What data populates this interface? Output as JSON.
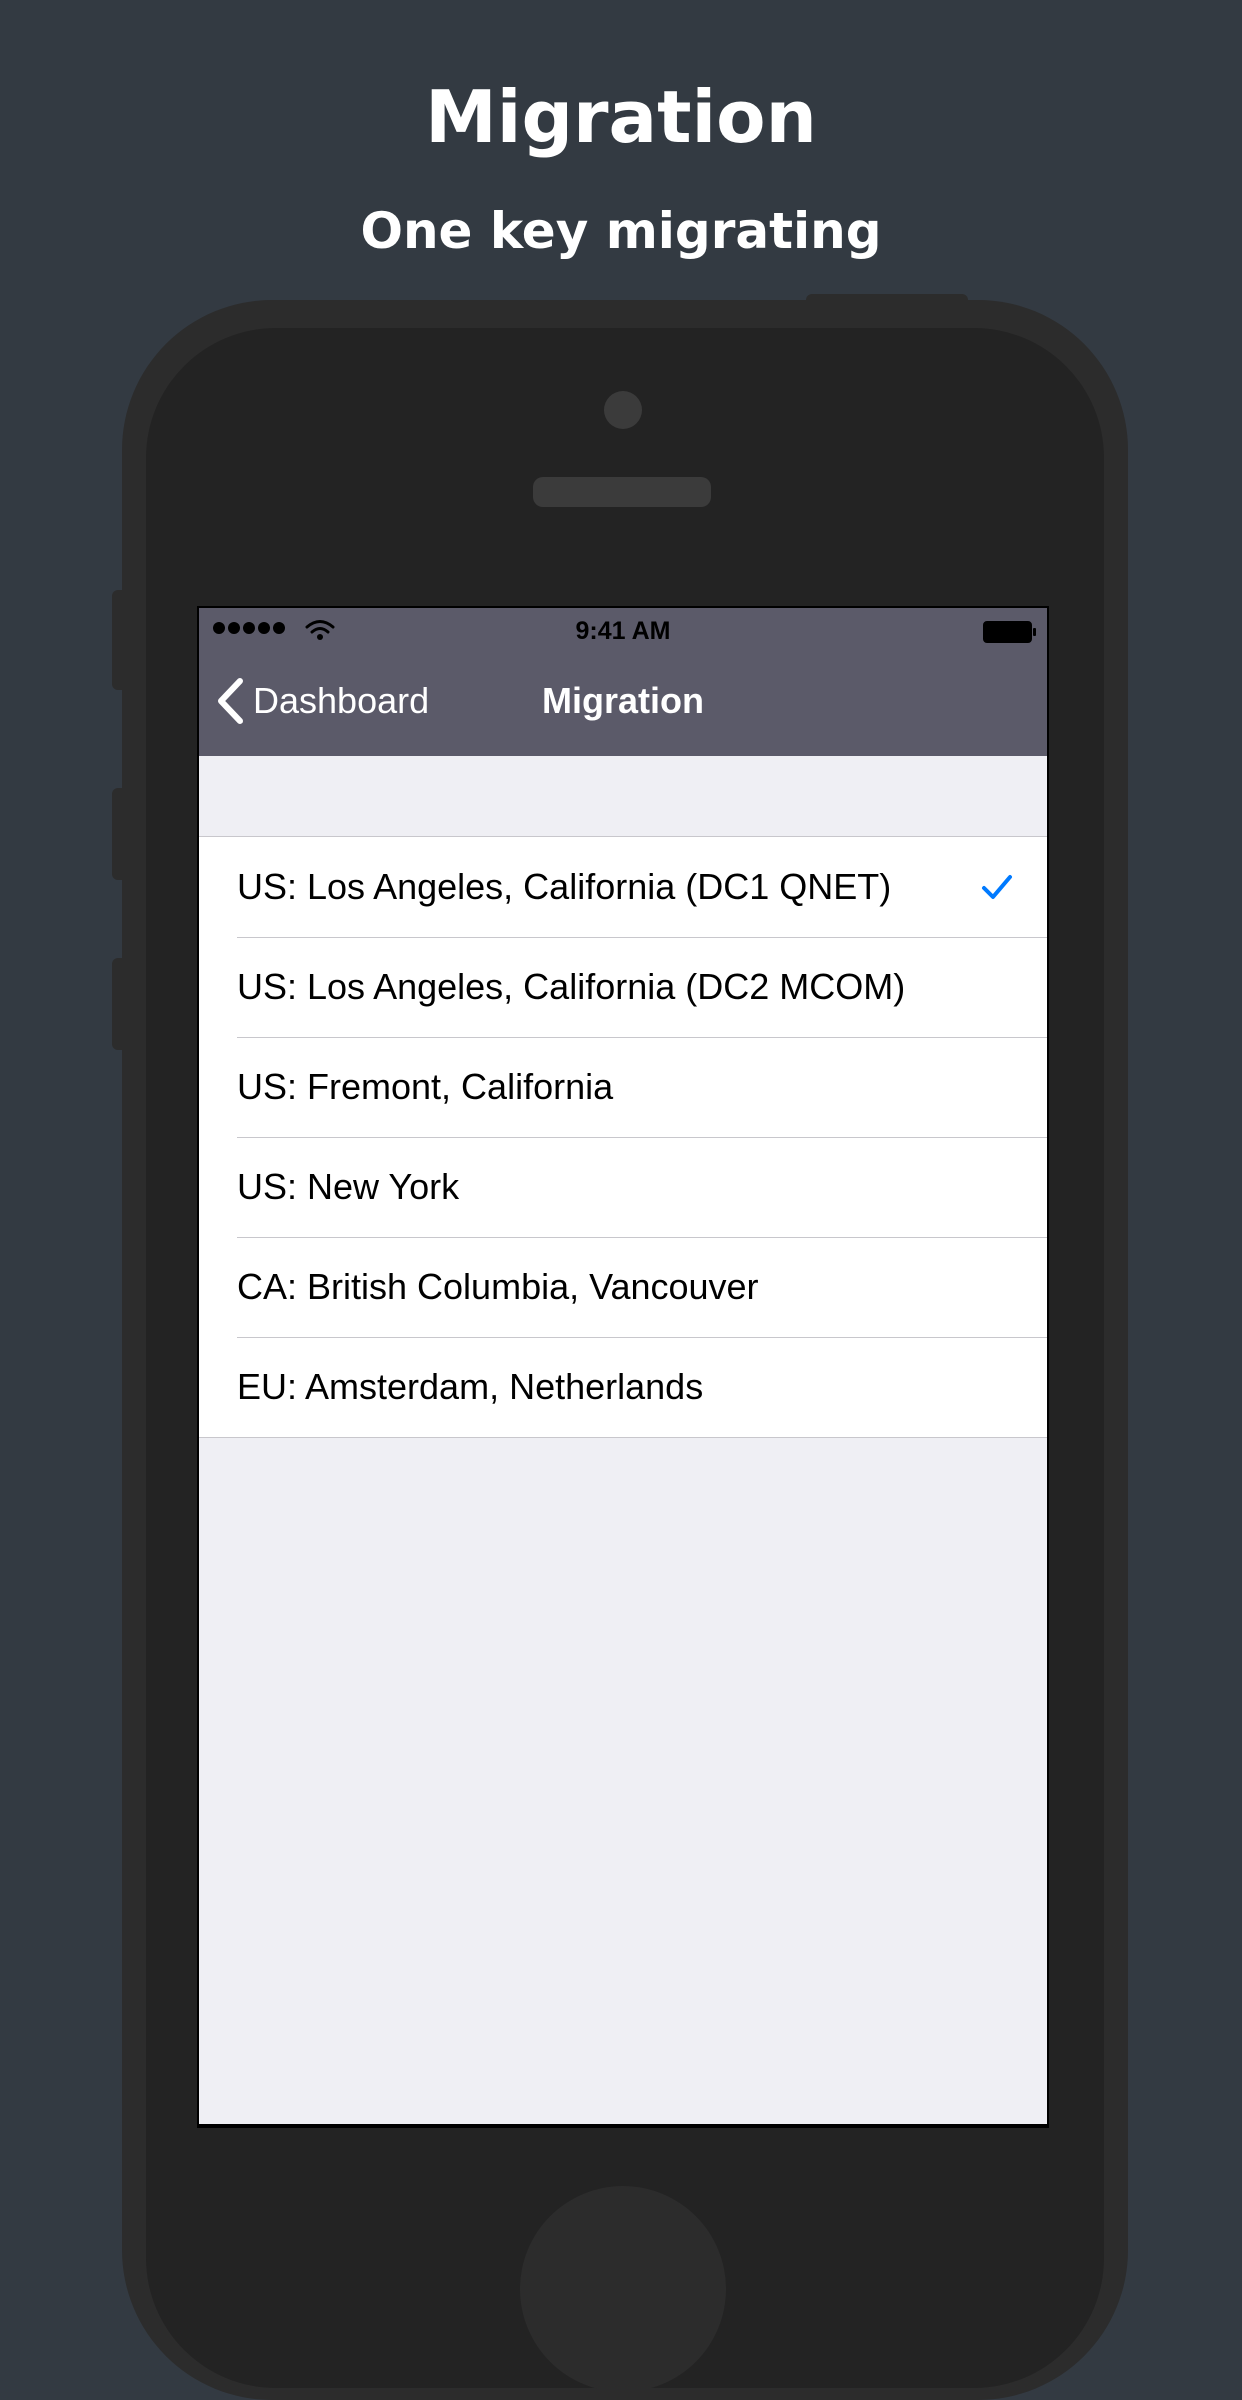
{
  "promo": {
    "title": "Migration",
    "subtitle": "One key migrating"
  },
  "status_bar": {
    "time": "9:41 AM",
    "signal_icon": "signal-dots-icon",
    "wifi_icon": "wifi-icon",
    "battery_icon": "battery-icon"
  },
  "nav": {
    "back_label": "Dashboard",
    "back_icon": "chevron-left-icon",
    "title": "Migration"
  },
  "locations": [
    {
      "label": "US: Los Angeles, California (DC1 QNET)",
      "selected": true
    },
    {
      "label": "US: Los Angeles, California (DC2 MCOM)",
      "selected": false
    },
    {
      "label": "US: Fremont, California",
      "selected": false
    },
    {
      "label": "US: New York",
      "selected": false
    },
    {
      "label": "CA: British Columbia, Vancouver",
      "selected": false
    },
    {
      "label": "EU: Amsterdam, Netherlands",
      "selected": false
    }
  ],
  "colors": {
    "background": "#333a42",
    "nav_bar": "#5b5a69",
    "table_background": "#efeff4",
    "checkmark": "#007aff"
  }
}
